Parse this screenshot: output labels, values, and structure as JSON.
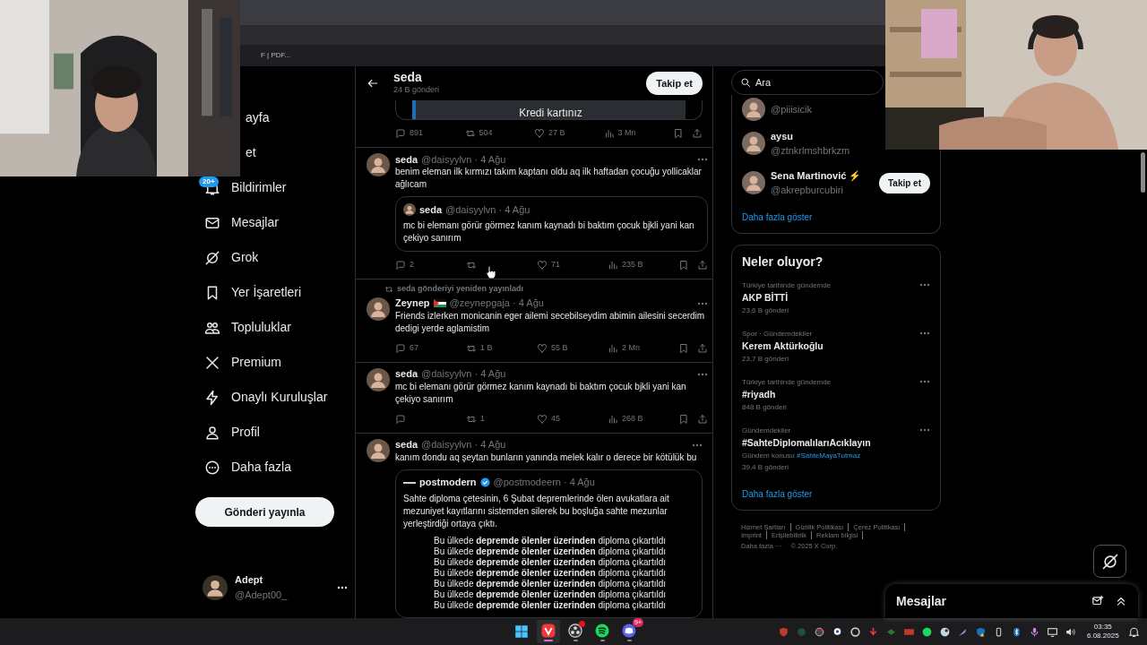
{
  "browser": {
    "bookmark": "F | PDF..."
  },
  "sidebar": {
    "items": [
      {
        "kind": "clipped",
        "label": "ayfa"
      },
      {
        "kind": "clipped",
        "label": "et"
      },
      {
        "kind": "nav",
        "label": "Bildirimler",
        "badge": "20+"
      },
      {
        "kind": "nav",
        "label": "Mesajlar"
      },
      {
        "kind": "nav",
        "label": "Grok"
      },
      {
        "kind": "nav",
        "label": "Yer İşaretleri"
      },
      {
        "kind": "nav",
        "label": "Topluluklar"
      },
      {
        "kind": "nav",
        "label": "Premium"
      },
      {
        "kind": "nav",
        "label": "Onaylı Kuruluşlar"
      },
      {
        "kind": "nav",
        "label": "Profil"
      },
      {
        "kind": "nav",
        "label": "Daha fazla"
      }
    ],
    "post_button": "Gönderi yayınla",
    "account": {
      "name": "Adept",
      "handle": "@Adept00_"
    }
  },
  "feed": {
    "header": {
      "title": "seda",
      "subtitle": "24 B gönderi",
      "follow": "Takip et"
    },
    "tweets": [
      {
        "kind": "partial",
        "media_text": "Kredi kartınız",
        "stats": {
          "replies": "891",
          "retweets": "504",
          "likes": "27 B",
          "views": "3 Mn"
        }
      },
      {
        "kind": "tweet",
        "name": "seda",
        "meta": "@daisyylvn · 4 Ağu",
        "text": "benim eleman ilk kırmızı takım kaptanı oldu aq ilk haftadan çocuğu yollicaklar ağlıcam",
        "quote": {
          "name": "seda",
          "meta": "@daisyylvn · 4 Ağu",
          "text": "mc bi elemanı görür görmez kanım kaynadı bi baktım çocuk bjkli yani kan çekiyo sanırım"
        },
        "stats": {
          "replies": "2",
          "likes": "71",
          "views": "235 B"
        }
      },
      {
        "kind": "tweet",
        "retweeted_by": "seda gönderiyi yeniden yayınladı",
        "name": "Zeynep",
        "flag": true,
        "meta": "@zeynepgaja · 4 Ağu",
        "text": "Friends izlerken monicanin eger ailemi secebilseydim abimin ailesini secerdim dedigi yerde aglamistim",
        "stats": {
          "replies": "67",
          "retweets": "1 B",
          "likes": "55 B",
          "views": "2 Mn"
        }
      },
      {
        "kind": "tweet",
        "name": "seda",
        "meta": "@daisyylvn · 4 Ağu",
        "text": "mc bi elemanı görür görmez kanım kaynadı bi baktım çocuk bjkli yani kan çekiyo sanırım",
        "stats": {
          "retweets": "1",
          "likes": "45",
          "views": "268 B"
        }
      },
      {
        "kind": "tweet",
        "name": "seda",
        "meta": "@daisyylvn · 4 Ağu",
        "text": "kanım dondu aq şeytan bunların yanında melek kalır o derece bir kötülük bu",
        "quote": {
          "kind": "logo",
          "name": "postmodern",
          "verified": true,
          "meta": "@postmodeern · 4 Ağu",
          "text": "Sahte diploma çetesinin, 6 Şubat depremlerinde ölen avukatlara ait mezuniyet kayıtlarını sistemden silerek bu boşluğa sahte mezunlar yerleştirdiği ortaya çıktı.",
          "image_lines": [
            "Bu ülkede **depremde ölenler üzerinden** diploma çıkartıldı",
            "Bu ülkede **depremde ölenler üzerinden** diploma çıkartıldı",
            "Bu ülkede **depremde ölenler üzerinden** diploma çıkartıldı",
            "Bu ülkede **depremde ölenler üzerinden** diploma çıkartıldı",
            "Bu ülkede **depremde ölenler üzerinden** diploma çıkartıldı",
            "Bu ülkede **depremde ölenler üzerinden** diploma çıkartıldı",
            "Bu ülkede **depremde ölenler üzerinden** diploma çıkartıldı"
          ]
        }
      }
    ]
  },
  "right": {
    "search": {
      "placeholder": "Ara"
    },
    "follow": {
      "items": [
        {
          "handle": "@piiisicik"
        },
        {
          "name": "aysu",
          "handle": "@ztnkrlmshbrkzm"
        },
        {
          "name": "Sena Martinović ⚡",
          "handle": "@akrepburcubiri",
          "button": "Takip et"
        }
      ],
      "more": "Daha fazla göster"
    },
    "trends": {
      "title": "Neler oluyor?",
      "items": [
        {
          "context": "Türkiye tarihinde gündemde",
          "title": "AKP BİTTİ",
          "count": "23,6 B gönderi"
        },
        {
          "context": "Spor · Gündemdekiler",
          "title": "Kerem Aktürkoğlu",
          "count": "23,7 B gönderi"
        },
        {
          "context": "Türkiye tarihinde gündemde",
          "title": "#riyadh",
          "count": "848 B gönderi"
        },
        {
          "context": "Gündemdekiler",
          "title": "#SahteDiplomalılarıAcıklayın",
          "topic_label": "Gündem konusu",
          "topic": "#SahteMayaTutmaz",
          "count": "39,4 B gönderi"
        }
      ],
      "more": "Daha fazla göster"
    },
    "footer": [
      [
        {
          "text": "Hizmet Şartları",
          "separator": true
        },
        {
          "text": "Gizlilik Politikası",
          "separator": true
        },
        {
          "text": "Çerez Politikası",
          "separator": true
        }
      ],
      [
        {
          "text": "Imprint",
          "separator": true
        },
        {
          "text": "Erişilebilirlik",
          "separator": true
        },
        {
          "text": "Reklam bilgisi",
          "separator": true
        }
      ],
      [
        {
          "text": "Daha fazla ···",
          "separator": false
        },
        {
          "text": "© 2025 X Corp.",
          "separator": false
        }
      ]
    ]
  },
  "messages": {
    "title": "Mesajlar"
  },
  "taskbar": {
    "apps": [
      {
        "selected": false,
        "running": false
      },
      {
        "selected": true,
        "running": true
      },
      {
        "selected": false,
        "running": true,
        "alert": true
      },
      {
        "selected": false,
        "running": true
      },
      {
        "selected": false,
        "running": true,
        "badge": "9+"
      }
    ],
    "time": "03:35",
    "date": "6.08.2025"
  }
}
